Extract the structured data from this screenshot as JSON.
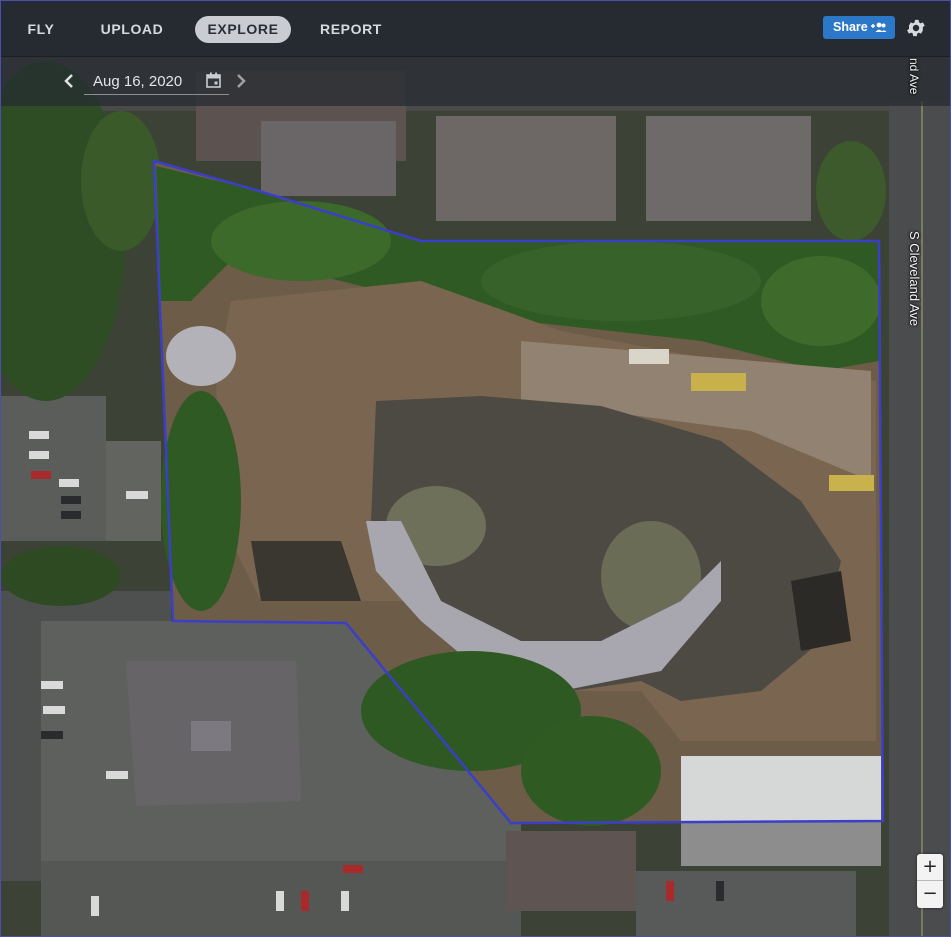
{
  "nav": {
    "tabs": [
      {
        "label": "FLY"
      },
      {
        "label": "UPLOAD"
      },
      {
        "label": "EXPLORE"
      },
      {
        "label": "REPORT"
      }
    ],
    "share_label": "Share",
    "settings_icon": "gear-icon"
  },
  "date_picker": {
    "value": "Aug 16, 2020",
    "prev_icon": "chevron-left-icon",
    "next_icon": "chevron-right-icon",
    "calendar_icon": "calendar-icon"
  },
  "map": {
    "street_label": "S Cleveland Ave",
    "street_label_top_partial": "nd Ave",
    "boundary_color": "#3b3fc8"
  },
  "zoom": {
    "zoom_in": "+",
    "zoom_out": "−"
  },
  "colors": {
    "nav_bg": "#262b31",
    "share_button": "#2c78c8",
    "active_tab": "#c9cdd1"
  }
}
